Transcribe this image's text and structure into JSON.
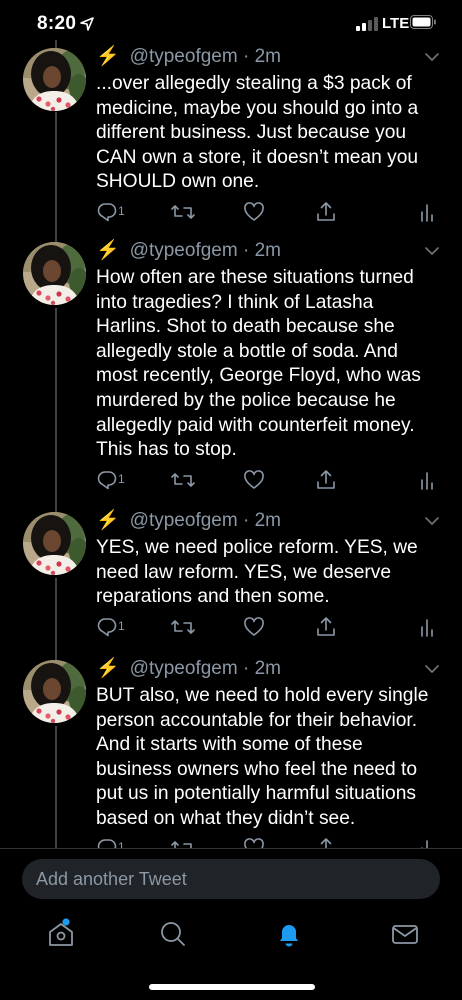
{
  "status_bar": {
    "time": "8:20",
    "network": "LTE"
  },
  "compose": {
    "placeholder": "Add another Tweet"
  },
  "tweets": [
    {
      "handle": "@typeofgem",
      "time": "2m",
      "text": "...over allegedly stealing a $3 pack of medicine, maybe you should go into a different business. Just because you CAN own a store, it doesn’t mean you SHOULD own one.",
      "reply_count": "1"
    },
    {
      "handle": "@typeofgem",
      "time": "2m",
      "text": "How often are these situations turned into tragedies? I think of Latasha Harlins. Shot to death because she allegedly stole a bottle of soda. And most recently, George Floyd, who was murdered by the police because he allegedly paid with counterfeit money. This has to stop.",
      "reply_count": "1"
    },
    {
      "handle": "@typeofgem",
      "time": "2m",
      "text": "YES, we need police reform. YES, we need law reform. YES, we deserve reparations and then some.",
      "reply_count": "1"
    },
    {
      "handle": "@typeofgem",
      "time": "2m",
      "text": "BUT also, we need to hold every single person accountable for their behavior. And it starts with some of these business owners who feel the need to put us in potentially harmful situations based on what they didn’t see.",
      "reply_count": "1"
    }
  ],
  "tabs": [
    {
      "name": "home",
      "icon": "home-icon",
      "has_dot": true
    },
    {
      "name": "search",
      "icon": "search-icon"
    },
    {
      "name": "notifications",
      "icon": "bell-icon",
      "active": true
    },
    {
      "name": "messages",
      "icon": "mail-icon"
    }
  ],
  "colors": {
    "accent": "#1d9bf0",
    "muted": "#8b98a5",
    "bolt": "#ffb900",
    "background": "#000000"
  }
}
